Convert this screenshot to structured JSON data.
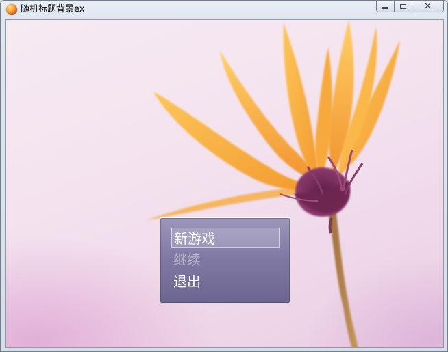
{
  "window": {
    "title": "随机标题背景ex",
    "app_icon": "game-icon",
    "buttons": [
      "minimize-icon",
      "maximize-icon",
      "close-icon"
    ],
    "close_glyph": "✕"
  },
  "title_menu": {
    "items": [
      {
        "label": "新游戏",
        "state": "selected"
      },
      {
        "label": "继续",
        "state": "disabled"
      },
      {
        "label": "退出",
        "state": "enabled"
      }
    ]
  },
  "colors": {
    "background_pink": "#f4e3ef",
    "petal_orange": "#f6a83a",
    "center_purple": "#7a2a5a",
    "menu_window": "#817aa4"
  }
}
